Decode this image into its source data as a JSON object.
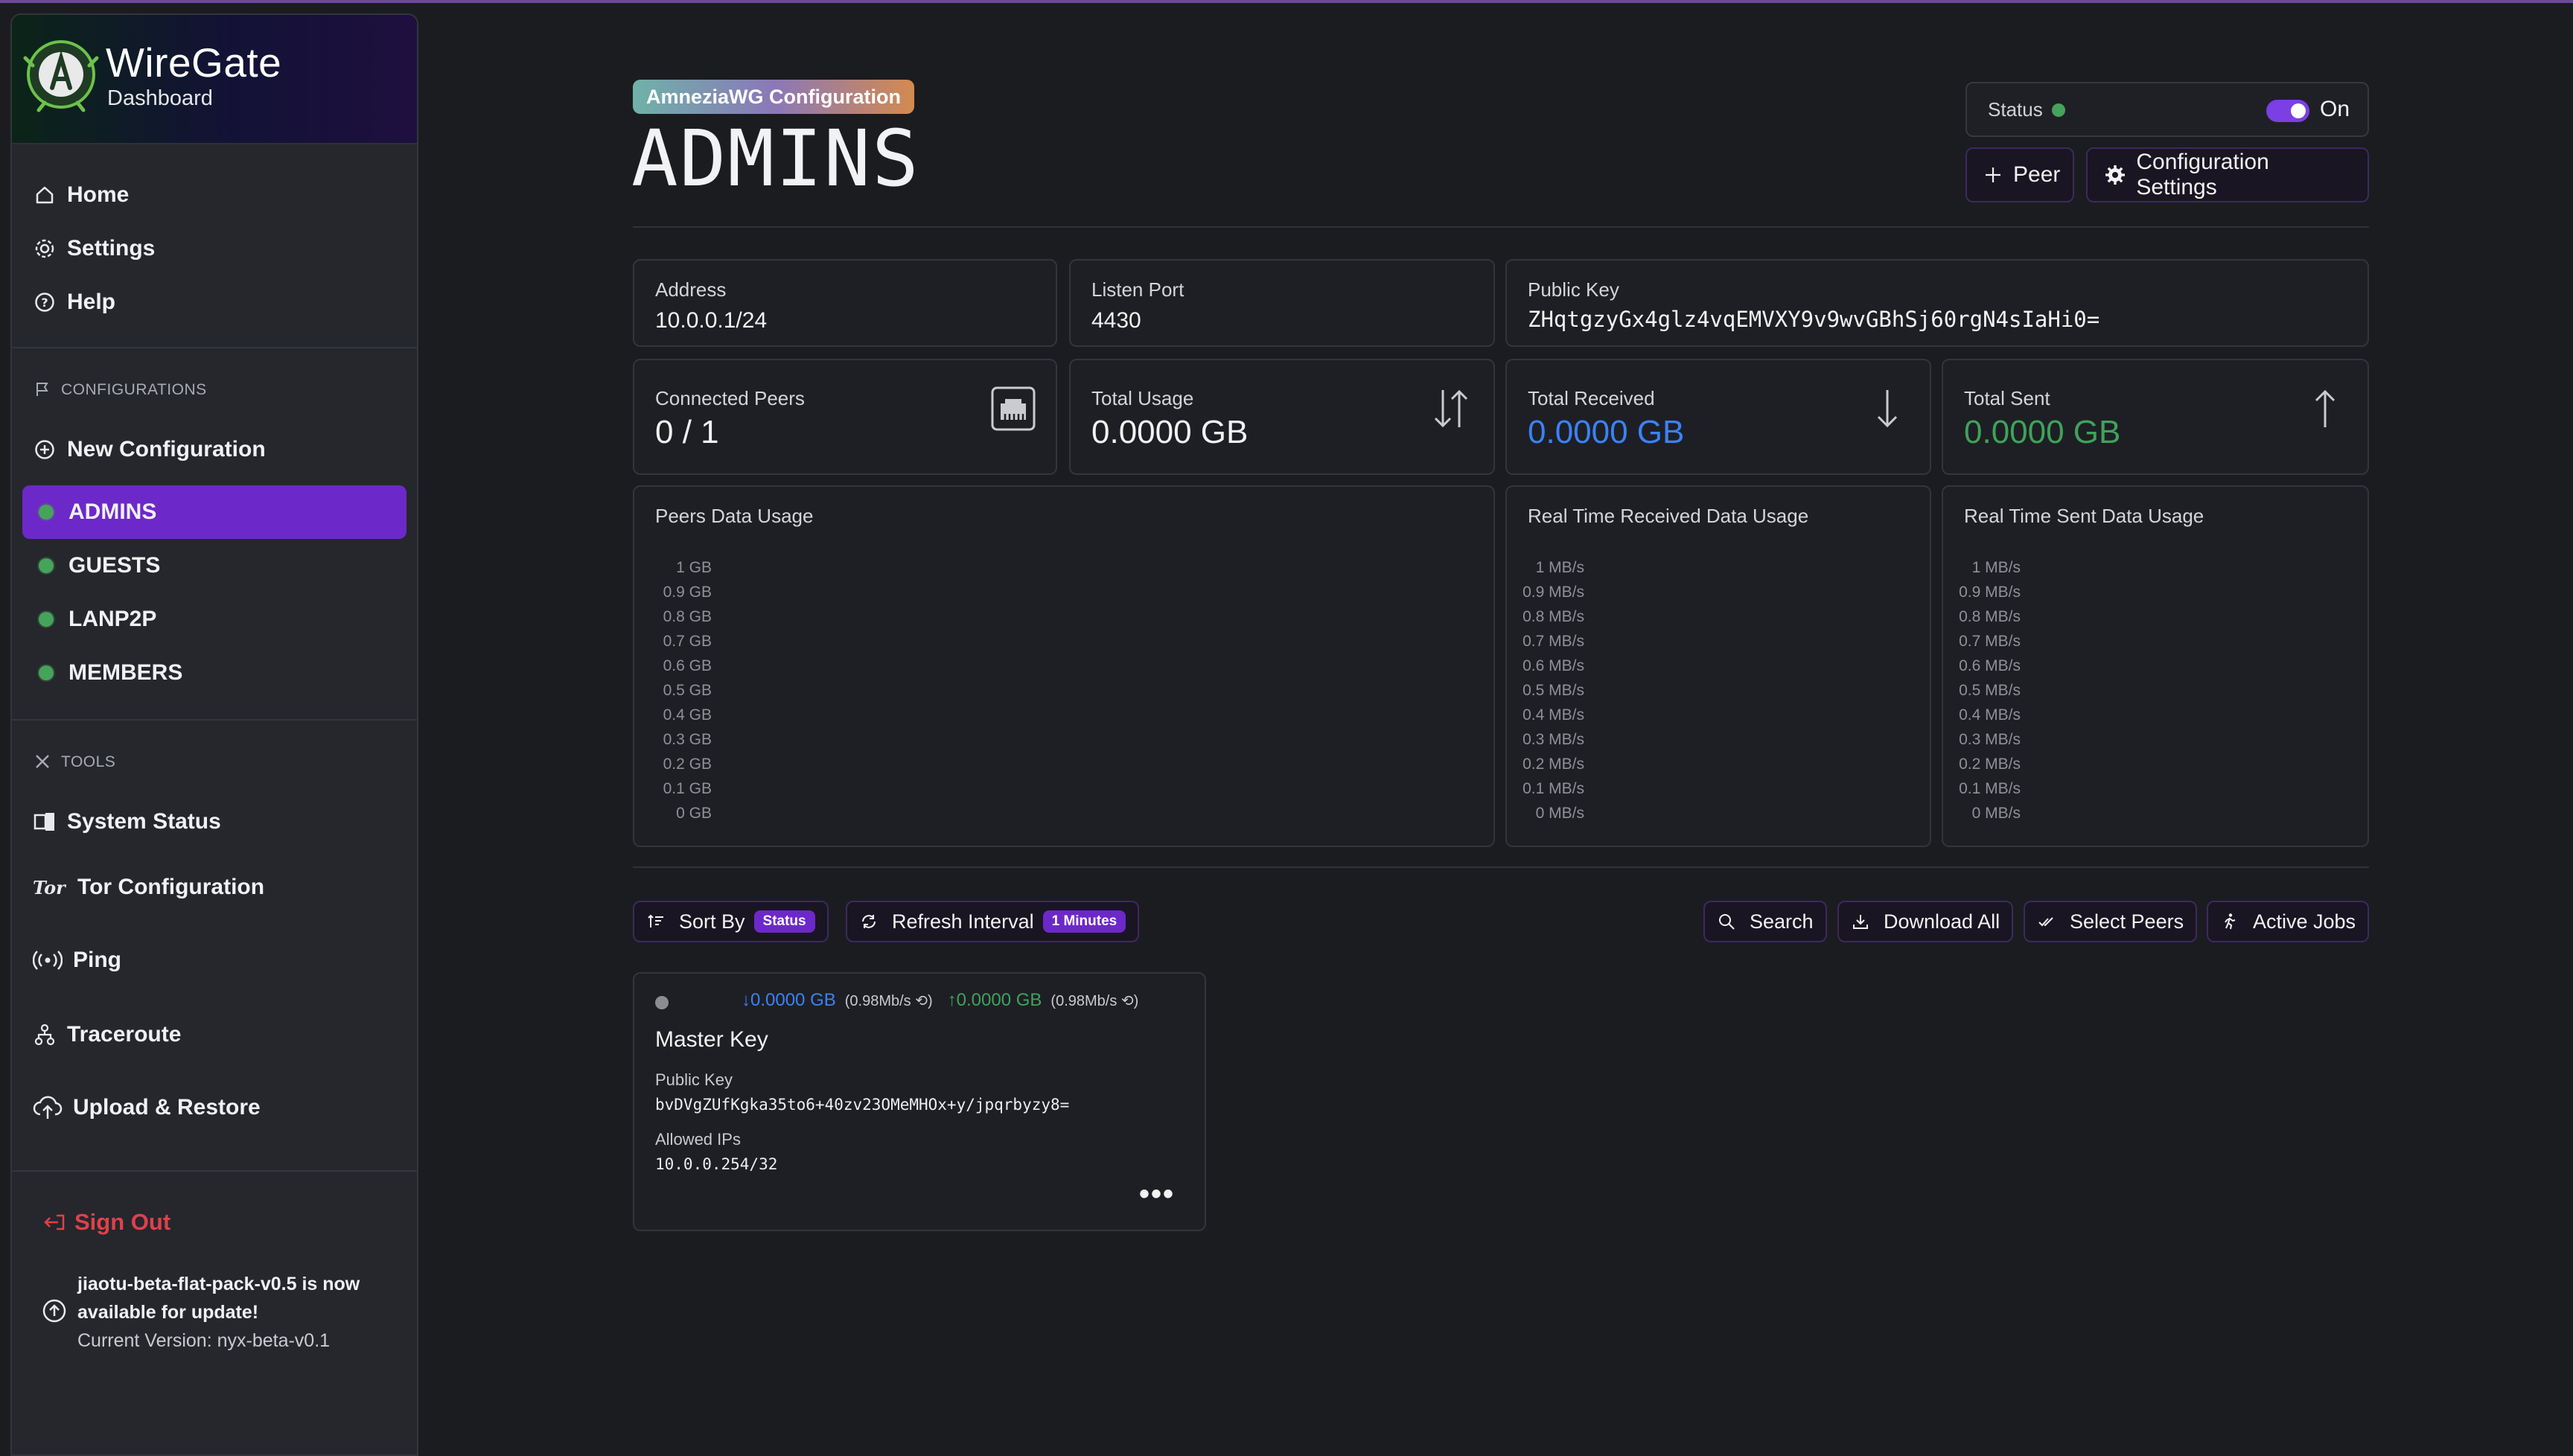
{
  "app": {
    "title": "WireGate",
    "subtitle": "Dashboard"
  },
  "sidebar": {
    "nav": [
      {
        "label": "Home",
        "icon": "home-icon"
      },
      {
        "label": "Settings",
        "icon": "gear-icon"
      },
      {
        "label": "Help",
        "icon": "help-icon"
      }
    ],
    "configurations_label": "CONFIGURATIONS",
    "new_configuration": "New Configuration",
    "configs": [
      {
        "label": "ADMINS",
        "active": true
      },
      {
        "label": "GUESTS",
        "active": false
      },
      {
        "label": "LANP2P",
        "active": false
      },
      {
        "label": "MEMBERS",
        "active": false
      }
    ],
    "tools_label": "TOOLS",
    "tools": [
      {
        "label": "System Status",
        "icon": "system-status-icon"
      },
      {
        "label": "Tor Configuration",
        "icon": "tor-icon"
      },
      {
        "label": "Ping",
        "icon": "ping-icon"
      },
      {
        "label": "Traceroute",
        "icon": "traceroute-icon"
      },
      {
        "label": "Upload & Restore",
        "icon": "upload-cloud-icon"
      }
    ],
    "sign_out": "Sign Out",
    "update_message": "jiaotu-beta-flat-pack-v0.5 is now available for update!",
    "current_version": "Current Version: nyx-beta-v0.1"
  },
  "header": {
    "badge": "AmneziaWG Configuration",
    "title": "ADMINS",
    "status_label": "Status",
    "status_value": "On",
    "peer_button": "Peer",
    "config_settings_button": "Configuration Settings"
  },
  "info": {
    "address_label": "Address",
    "address": "10.0.0.1/24",
    "port_label": "Listen Port",
    "port": "4430",
    "pubkey_label": "Public Key",
    "pubkey": "ZHqtgzyGx4glz4vqEMVXY9v9wvGBhSj60rgN4sIaHi0="
  },
  "stats": {
    "connected_label": "Connected Peers",
    "connected": "0 / 1",
    "usage_label": "Total Usage",
    "usage": "0.0000 GB",
    "received_label": "Total Received",
    "received": "0.0000 GB",
    "sent_label": "Total Sent",
    "sent": "0.0000 GB"
  },
  "colors": {
    "accent": "#6d28c9",
    "received": "#3b82f6",
    "sent": "#3ea35b",
    "online": "#46a35a",
    "danger": "#e0404a"
  },
  "chart_data": [
    {
      "type": "bar",
      "title": "Peers Data Usage",
      "yticks": [
        "1 GB",
        "0.9 GB",
        "0.8 GB",
        "0.7 GB",
        "0.6 GB",
        "0.5 GB",
        "0.4 GB",
        "0.3 GB",
        "0.2 GB",
        "0.1 GB",
        "0 GB"
      ],
      "ylim": [
        0,
        1
      ],
      "series": []
    },
    {
      "type": "line",
      "title": "Real Time Received Data Usage",
      "yticks": [
        "1 MB/s",
        "0.9 MB/s",
        "0.8 MB/s",
        "0.7 MB/s",
        "0.6 MB/s",
        "0.5 MB/s",
        "0.4 MB/s",
        "0.3 MB/s",
        "0.2 MB/s",
        "0.1 MB/s",
        "0 MB/s"
      ],
      "ylim": [
        0,
        1
      ],
      "series": []
    },
    {
      "type": "line",
      "title": "Real Time Sent Data Usage",
      "yticks": [
        "1 MB/s",
        "0.9 MB/s",
        "0.8 MB/s",
        "0.7 MB/s",
        "0.6 MB/s",
        "0.5 MB/s",
        "0.4 MB/s",
        "0.3 MB/s",
        "0.2 MB/s",
        "0.1 MB/s",
        "0 MB/s"
      ],
      "ylim": [
        0,
        1
      ],
      "series": []
    }
  ],
  "toolbar": {
    "sort_by": "Sort By",
    "sort_pill": "Status",
    "refresh": "Refresh Interval",
    "refresh_pill": "1 Minutes",
    "search": "Search",
    "download_all": "Download All",
    "select_peers": "Select Peers",
    "active_jobs": "Active Jobs"
  },
  "peer": {
    "received": "0.0000 GB",
    "received_rate": "(0.98Mb/s ⟲)",
    "sent": "0.0000 GB",
    "sent_rate": "(0.98Mb/s ⟲)",
    "name": "Master Key",
    "pubkey_label": "Public Key",
    "pubkey": "bvDVgZUfKgka35to6+40zv23OMeMHOx+y/jpqrbyzy8=",
    "allowed_label": "Allowed IPs",
    "allowed": "10.0.0.254/32",
    "more": "•••"
  }
}
